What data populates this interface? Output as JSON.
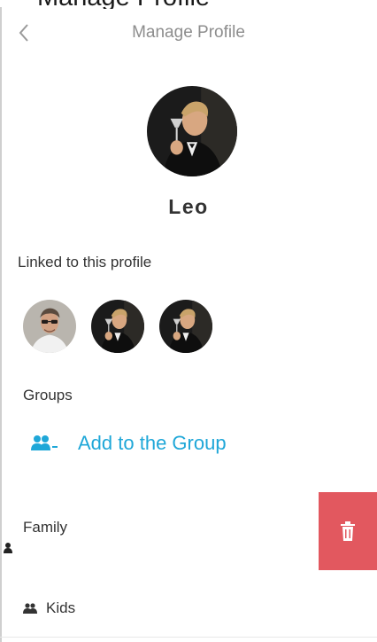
{
  "top_clipped_text": "Manage Profile",
  "header": {
    "title": "Manage Profile"
  },
  "profile": {
    "name": "Leo"
  },
  "linked": {
    "label": "Linked to this profile",
    "avatars": [
      "person-with-sunglasses-avatar",
      "man-toasting-avatar",
      "man-toasting-avatar"
    ]
  },
  "groups": {
    "label": "Groups",
    "add_label": "Add to the Group",
    "items": [
      {
        "label": "Family",
        "icon": "person-icon"
      },
      {
        "label": "Kids",
        "icon": "group-icon"
      }
    ]
  },
  "colors": {
    "accent": "#1fa7d8",
    "delete": "#e2585f",
    "header_text": "#8d8d8d"
  },
  "icons": {
    "back": "chevron-left-icon",
    "add_group": "add-group-icon",
    "delete": "trash-icon"
  }
}
